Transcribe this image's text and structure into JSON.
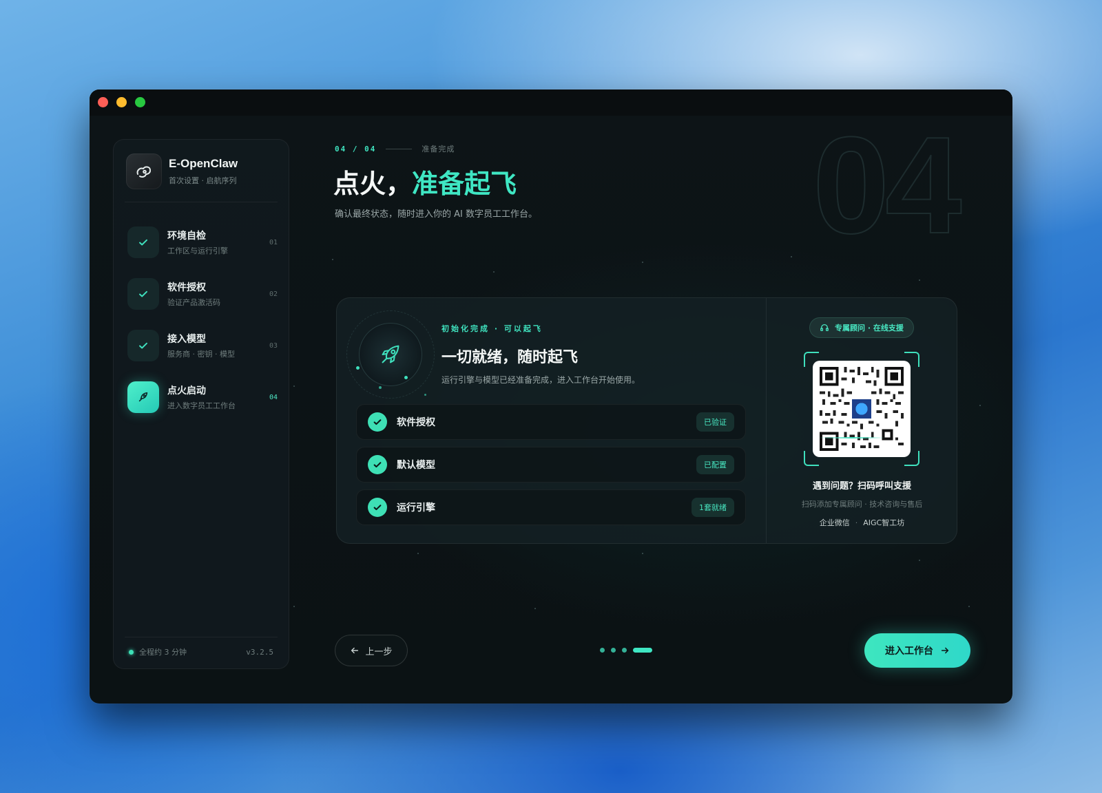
{
  "window": {
    "controls": [
      "close",
      "minimize",
      "zoom"
    ]
  },
  "brand": {
    "name": "E-OpenClaw",
    "subtitle": "首次设置 · 启航序列",
    "icon": "claw-logo-icon"
  },
  "steps": [
    {
      "title": "环境自检",
      "subtitle": "工作区与运行引擎",
      "num": "01",
      "state": "done",
      "icon": "check-icon"
    },
    {
      "title": "软件授权",
      "subtitle": "验证产品激活码",
      "num": "02",
      "state": "done",
      "icon": "check-icon"
    },
    {
      "title": "接入模型",
      "subtitle": "服务商 · 密钥 · 模型",
      "num": "03",
      "state": "done",
      "icon": "check-icon"
    },
    {
      "title": "点火启动",
      "subtitle": "进入数字员工工作台",
      "num": "04",
      "state": "active",
      "icon": "rocket-icon"
    }
  ],
  "sidebar_footer": {
    "duration": "全程约 3 分钟",
    "version": "v3.2.5"
  },
  "header": {
    "step_indicator": "04 / 04",
    "step_label": "准备完成",
    "title_prefix": "点火，",
    "title_accent": "准备起飞",
    "subtitle": "确认最终状态，随时进入你的 AI 数字员工工作台。",
    "watermark": "04"
  },
  "card": {
    "tag": "初始化完成 · 可以起飞",
    "title": "一切就绪，随时起飞",
    "description": "运行引擎与模型已经准备完成，进入工作台开始使用。",
    "checks": [
      {
        "label": "软件授权",
        "badge": "已验证"
      },
      {
        "label": "默认模型",
        "badge": "已配置"
      },
      {
        "label": "运行引擎",
        "badge": "1套就绪"
      }
    ]
  },
  "support": {
    "pill": "专属顾问 · 在线支援",
    "title": "遇到问题？扫码呼叫支援",
    "subtitle": "扫码添加专属顾问 · 技术咨询与售后",
    "link_left": "企业微信",
    "separator": "·",
    "link_right": "AIGC智工坊"
  },
  "footer": {
    "back_label": "上一步",
    "enter_label": "进入工作台",
    "pager_total": 4,
    "pager_current": 4
  },
  "colors": {
    "accent": "#3fe6c3",
    "background": "#0b1214",
    "text": "#f4f7f6"
  }
}
